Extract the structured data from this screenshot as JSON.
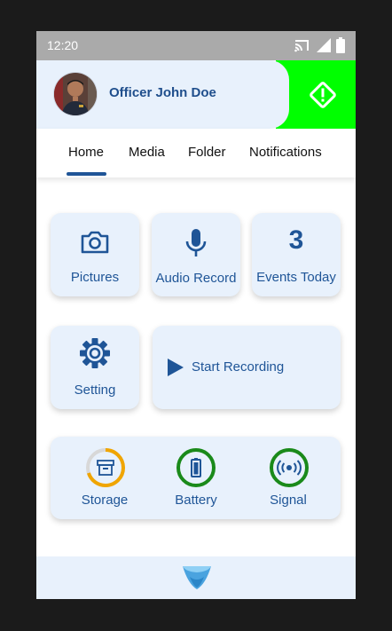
{
  "status_bar": {
    "time": "12:20",
    "icons": [
      "cast-icon",
      "signal-icon",
      "battery-icon"
    ]
  },
  "header": {
    "officer_name": "Officer John Doe",
    "alert_button_icon": "alert-diamond-icon",
    "alert_color": "#00ff00"
  },
  "tabs": [
    {
      "label": "Home",
      "active": true
    },
    {
      "label": "Media"
    },
    {
      "label": "Folder"
    },
    {
      "label": "Notifications"
    }
  ],
  "tiles": {
    "pictures": {
      "label": "Pictures",
      "icon": "camera-icon"
    },
    "audio": {
      "label": "Audio Record",
      "icon": "microphone-icon"
    },
    "events": {
      "count": "3",
      "label": "Events Today"
    },
    "setting": {
      "label": "Setting",
      "icon": "gear-icon"
    },
    "start_recording": {
      "label": "Start Recording",
      "icon": "play-icon"
    }
  },
  "status_panel": {
    "storage": {
      "label": "Storage",
      "icon": "archive-icon",
      "ring_color": "#f0a500",
      "fill_fraction": 0.7
    },
    "battery": {
      "label": "Battery",
      "icon": "battery-icon",
      "ring_color": "#1a8a1a",
      "fill_fraction": 1.0
    },
    "signal": {
      "label": "Signal",
      "icon": "broadcast-icon",
      "ring_color": "#1a8a1a",
      "fill_fraction": 1.0
    }
  },
  "colors": {
    "primary": "#1f5597",
    "tile_bg": "#e8f1fc",
    "statusbar_bg": "#aaaaaa"
  }
}
